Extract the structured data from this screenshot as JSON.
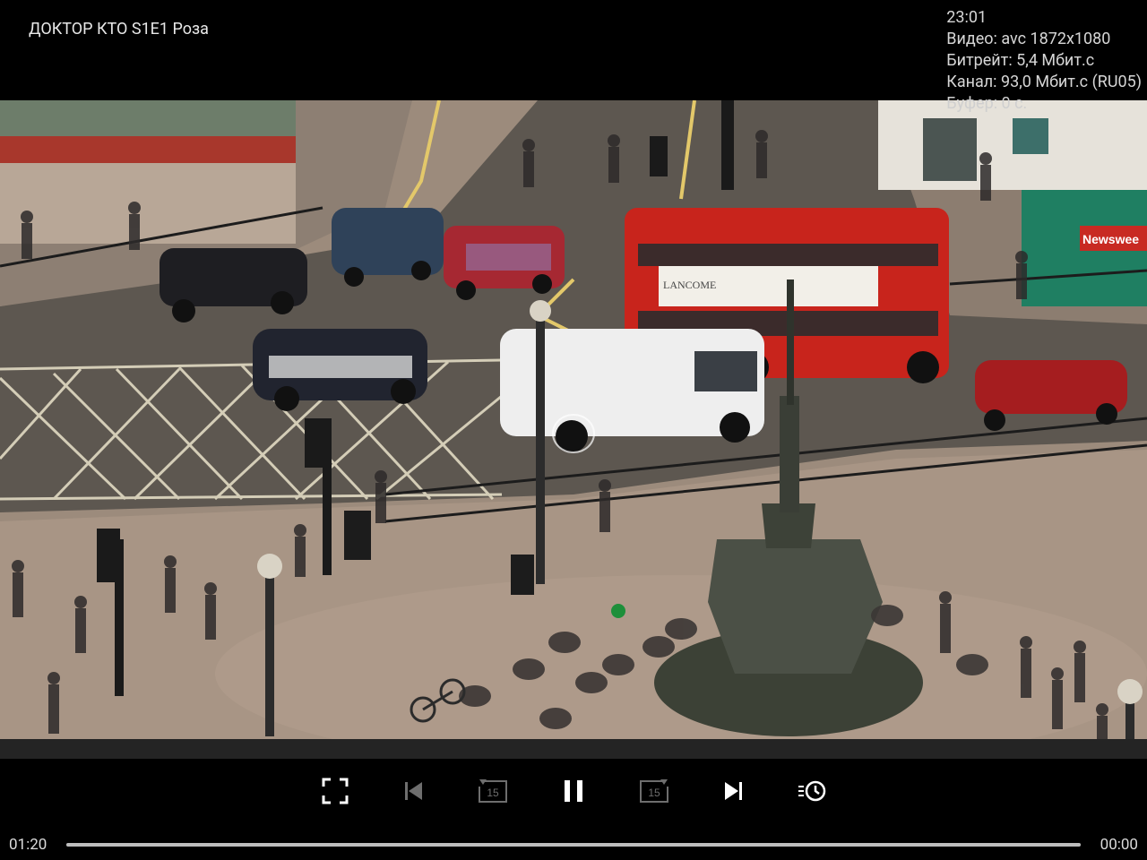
{
  "title": "ДОКТОР КТО S1E1 Роза",
  "stats": {
    "clock": "23:01",
    "video": "Видео: avc 1872x1080",
    "bitrate": "Битрейт: 5,4 Мбит.с",
    "channel": "Канал: 93,0 Мбит.с (RU05)",
    "buffer": "Буфер: 0 с."
  },
  "video_frame": {
    "scene": "street-junction-with-bus-taxis-fountain"
  },
  "frame_text": {
    "advert": "LANCOME",
    "kiosk": "Newswee"
  },
  "controls": {
    "fullscreen_icon": "fullscreen-icon",
    "previous_icon": "skip-previous-icon",
    "rewind_icon": "replay-15-icon",
    "rewind_value": "15",
    "play_pause_icon": "pause-icon",
    "forward_icon": "forward-15-icon",
    "forward_value": "15",
    "next_icon": "skip-next-icon",
    "history_icon": "history-list-icon"
  },
  "timeline": {
    "elapsed": "01:20",
    "remaining": "00:00",
    "progress_percent": 100
  },
  "colors": {
    "background": "#000000",
    "text": "#e8e8e8",
    "progress_track": "#3a3a3a",
    "progress_fill": "#bdbdbd",
    "bus_red": "#c8241c"
  }
}
